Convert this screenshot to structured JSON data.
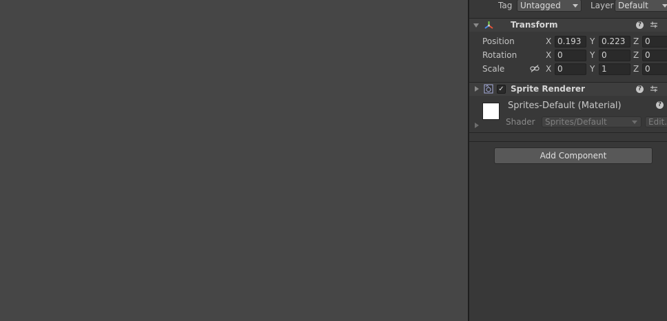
{
  "object_header": {
    "tag_label": "Tag",
    "tag_value": "Untagged",
    "layer_label": "Layer",
    "layer_value": "Default"
  },
  "transform": {
    "title": "Transform",
    "position": {
      "label": "Position",
      "x_axis": "X",
      "x": "0.193",
      "y_axis": "Y",
      "y": "0.223",
      "z_axis": "Z",
      "z": "0"
    },
    "rotation": {
      "label": "Rotation",
      "x_axis": "X",
      "x": "0",
      "y_axis": "Y",
      "y": "0",
      "z_axis": "Z",
      "z": "0"
    },
    "scale": {
      "label": "Scale",
      "x_axis": "X",
      "x": "0",
      "y_axis": "Y",
      "y": "1",
      "z_axis": "Z",
      "z": "0"
    }
  },
  "sprite_renderer": {
    "title": "Sprite Renderer",
    "enabled_glyph": "✓"
  },
  "material": {
    "name": "Sprites-Default (Material)",
    "shader_label": "Shader",
    "shader_value": "Sprites/Default",
    "edit_label": "Edit..."
  },
  "help_glyph": "?",
  "add_component_label": "Add Component",
  "colors": {
    "scene_bg": "#464646",
    "inspector_bg": "#383838",
    "header_bg": "#3e3e3e",
    "field_bg": "#2a2a2a",
    "button_bg": "#585858"
  }
}
